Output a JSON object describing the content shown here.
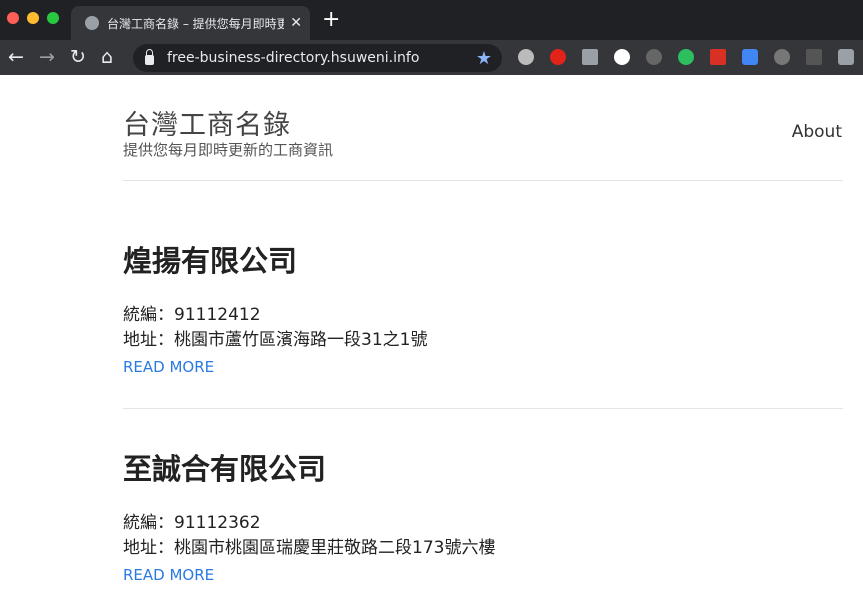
{
  "browser": {
    "tab_title": "台灣工商名錄 – 提供您每月即時更新的工商資訊",
    "url": "free-business-directory.hsuweni.info"
  },
  "site": {
    "title": "台灣工商名錄",
    "subtitle": "提供您每月即時更新的工商資訊",
    "nav_about": "About"
  },
  "posts": [
    {
      "title": "煌揚有限公司",
      "tax_id": "統編：91112412",
      "address": "地址：桃園市蘆竹區濱海路一段31之1號",
      "more": "READ MORE"
    },
    {
      "title": "至誠合有限公司",
      "tax_id": "統編：91112362",
      "address": "地址：桃園市桃園區瑞慶里莊敬路二段173號六樓",
      "more": "READ MORE"
    }
  ]
}
